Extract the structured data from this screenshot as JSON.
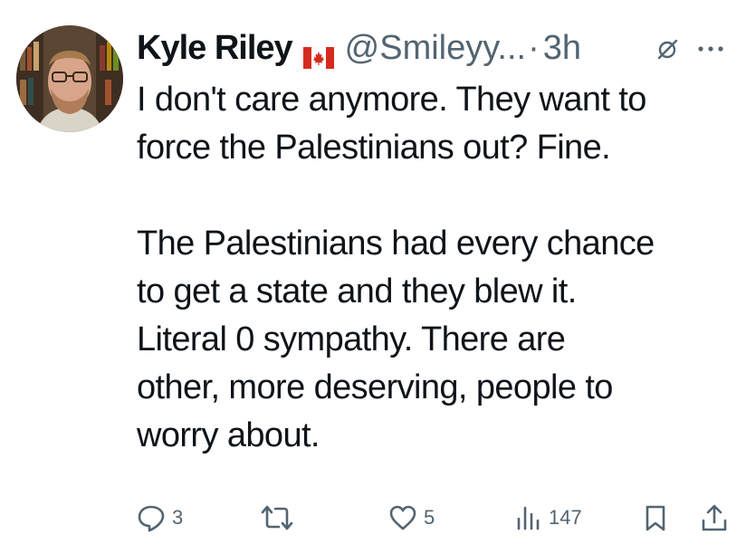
{
  "author": {
    "display_name": "Kyle Riley",
    "flag_icon": "canada-flag-icon",
    "handle": "@Smileyy...",
    "separator": "·",
    "time": "3h"
  },
  "tweet": {
    "paragraphs": [
      "I don't care anymore. They want to\nforce the Palestinians out? Fine.",
      "The Palestinians had every chance\nto get a state and they blew it.\nLiteral 0 sympathy. There are\nother, more deserving, people to\nworry about."
    ]
  },
  "actions": {
    "replies": "3",
    "retweets": "",
    "likes": "5",
    "views": "147"
  },
  "colors": {
    "text": "#0f1419",
    "secondary": "#536471",
    "flag_red": "#d52b1e"
  }
}
